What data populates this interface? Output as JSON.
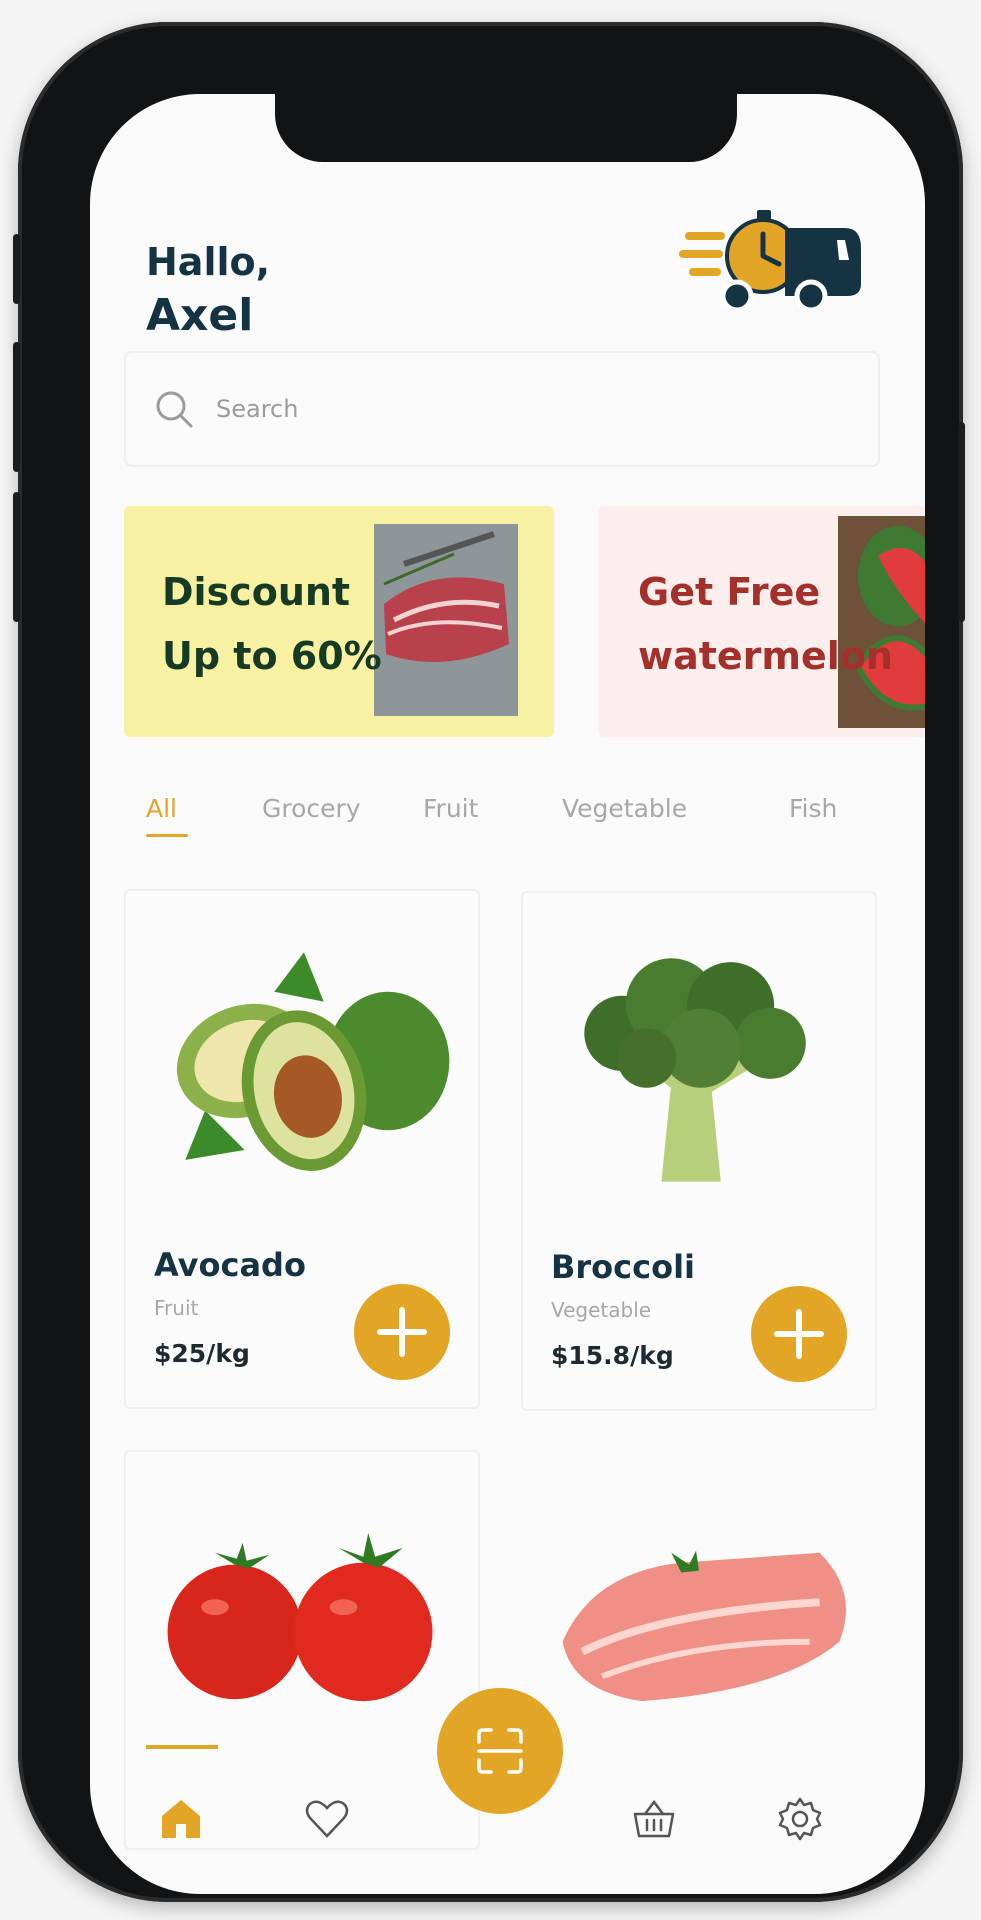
{
  "header": {
    "greeting_line1": "Hallo,",
    "greeting_line2": "Axel"
  },
  "search": {
    "placeholder": "Search"
  },
  "banners": [
    {
      "line1": "Discount",
      "line2": "Up to 60%",
      "background": "#f8f0a2",
      "text_color": "#163a24"
    },
    {
      "line1": "Get Free",
      "line2": "watermelon",
      "background": "#fdeeee",
      "text_color": "#a3302a"
    }
  ],
  "categories": {
    "active": "All",
    "items": [
      "All",
      "Grocery",
      "Fruit",
      "Vegetable",
      "Fish"
    ]
  },
  "products": [
    {
      "name": "Avocado",
      "category": "Fruit",
      "price": "$25/kg",
      "image": "avocado"
    },
    {
      "name": "Broccoli",
      "category": "Vegetable",
      "price": "$15.8/kg",
      "image": "broccoli"
    },
    {
      "name": "",
      "category": "",
      "price": "",
      "image": "tomatoes"
    },
    {
      "name": "",
      "category": "",
      "price": "",
      "image": "raw-meat"
    }
  ],
  "bottom_nav": {
    "items": [
      {
        "icon": "home-icon",
        "active": true
      },
      {
        "icon": "heart-icon",
        "active": false
      },
      {
        "icon": "scan-icon",
        "active": false
      },
      {
        "icon": "basket-icon",
        "active": false
      },
      {
        "icon": "gear-icon",
        "active": false
      }
    ]
  },
  "colors": {
    "accent": "#e2a526",
    "heading": "#163343",
    "muted": "#a7a7a7"
  }
}
